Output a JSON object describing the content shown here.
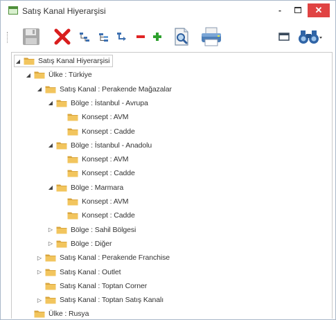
{
  "window": {
    "title": "Satış Kanal Hiyerarşisi",
    "minimize_glyph": "-",
    "close_glyph": "✕",
    "colors": {
      "close": "#e04343",
      "folder": "#f2c55e",
      "folder_dark": "#d9a53d"
    }
  },
  "toolbar": {
    "buttons": [
      {
        "name": "save",
        "icon": "floppy-disk-icon",
        "enabled": false
      },
      {
        "name": "delete",
        "icon": "red-x-icon"
      },
      {
        "name": "indent-tree",
        "icon": "tree-structure-icon"
      },
      {
        "name": "tree-expand",
        "icon": "tree-branch-icon"
      },
      {
        "name": "move-down",
        "icon": "arrow-down-right-icon"
      },
      {
        "name": "remove",
        "icon": "minus-icon"
      },
      {
        "name": "add",
        "icon": "plus-icon"
      },
      {
        "name": "preview",
        "icon": "document-search-icon"
      },
      {
        "name": "print",
        "icon": "printer-icon"
      },
      {
        "name": "window-view",
        "icon": "window-icon"
      },
      {
        "name": "find",
        "icon": "binoculars-icon"
      }
    ]
  },
  "tree": {
    "nodes": [
      {
        "label": "Satış Kanal Hiyerarşisi",
        "level": 0,
        "expander": "expanded",
        "selected": true
      },
      {
        "label": "Ülke : Türkiye",
        "level": 1,
        "expander": "expanded"
      },
      {
        "label": "Satış Kanal : Perakende Mağazalar",
        "level": 2,
        "expander": "expanded"
      },
      {
        "label": "Bölge : İstanbul - Avrupa",
        "level": 3,
        "expander": "expanded"
      },
      {
        "label": "Konsept : AVM",
        "level": 4,
        "expander": "none"
      },
      {
        "label": "Konsept : Cadde",
        "level": 4,
        "expander": "none"
      },
      {
        "label": "Bölge : İstanbul - Anadolu",
        "level": 3,
        "expander": "expanded"
      },
      {
        "label": "Konsept : AVM",
        "level": 4,
        "expander": "none"
      },
      {
        "label": "Konsept : Cadde",
        "level": 4,
        "expander": "none"
      },
      {
        "label": "Bölge : Marmara",
        "level": 3,
        "expander": "expanded"
      },
      {
        "label": "Konsept : AVM",
        "level": 4,
        "expander": "none"
      },
      {
        "label": "Konsept : Cadde",
        "level": 4,
        "expander": "none"
      },
      {
        "label": "Bölge : Sahil Bölgesi",
        "level": 3,
        "expander": "collapsed"
      },
      {
        "label": "Bölge : Diğer",
        "level": 3,
        "expander": "collapsed"
      },
      {
        "label": "Satış Kanal : Perakende Franchise",
        "level": 2,
        "expander": "collapsed"
      },
      {
        "label": "Satış Kanal : Outlet",
        "level": 2,
        "expander": "collapsed"
      },
      {
        "label": "Satış Kanal : Toptan Corner",
        "level": 2,
        "expander": "none"
      },
      {
        "label": "Satış Kanal : Toptan Satış Kanalı",
        "level": 2,
        "expander": "collapsed"
      },
      {
        "label": "Ülke : Rusya",
        "level": 1,
        "expander": "none"
      }
    ]
  }
}
